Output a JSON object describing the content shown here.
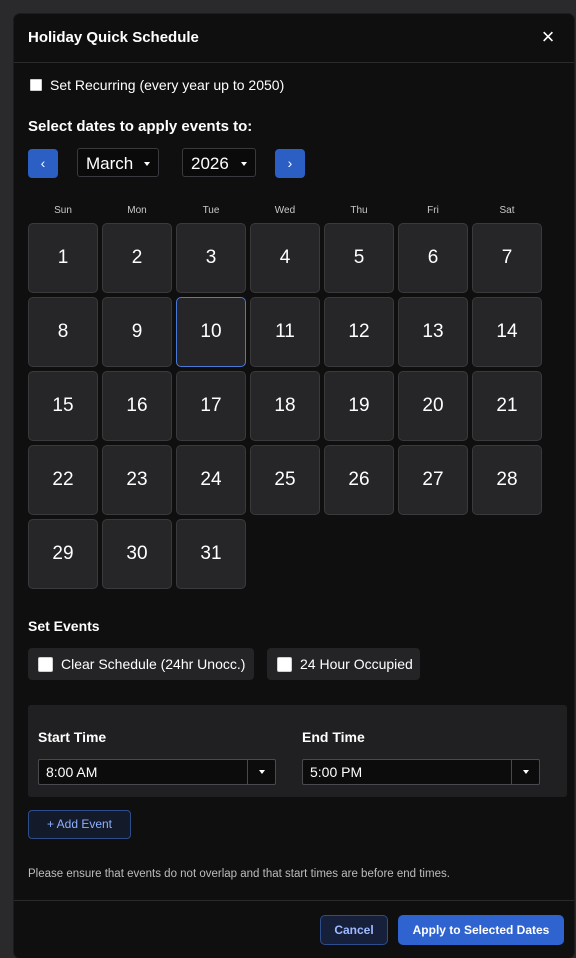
{
  "dialog": {
    "title": "Holiday Quick Schedule",
    "close_icon": "×"
  },
  "recurring": {
    "label": "Set Recurring (every year up to 2050)",
    "checked": false
  },
  "calendar": {
    "heading": "Select dates to apply events to:",
    "prev_icon": "‹",
    "next_icon": "›",
    "month": "March",
    "year": "2026",
    "weekdays": [
      "Sun",
      "Mon",
      "Tue",
      "Wed",
      "Thu",
      "Fri",
      "Sat"
    ],
    "days": [
      "1",
      "2",
      "3",
      "4",
      "5",
      "6",
      "7",
      "8",
      "9",
      "10",
      "11",
      "12",
      "13",
      "14",
      "15",
      "16",
      "17",
      "18",
      "19",
      "20",
      "21",
      "22",
      "23",
      "24",
      "25",
      "26",
      "27",
      "28",
      "29",
      "30",
      "31"
    ],
    "first_weekday_index": 0,
    "highlighted_day": "10"
  },
  "events": {
    "heading": "Set Events",
    "options": [
      {
        "label": "Clear Schedule (24hr Unocc.)",
        "checked": false
      },
      {
        "label": "24 Hour Occupied",
        "checked": false
      }
    ]
  },
  "time": {
    "start_label": "Start Time",
    "start_value": "8:00 AM",
    "end_label": "End Time",
    "end_value": "5:00 PM"
  },
  "add_event_label": "+ Add Event",
  "note": "Please ensure that events do not overlap and that start times are before end times.",
  "footer": {
    "cancel_label": "Cancel",
    "apply_label": "Apply to Selected Dates"
  },
  "colors": {
    "accent": "#2f63d0",
    "background": "#0f0f10",
    "day_cell": "#262628"
  }
}
